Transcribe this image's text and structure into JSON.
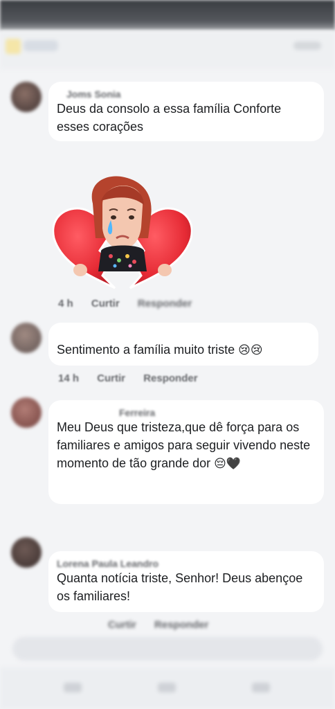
{
  "comments": [
    {
      "author": "Joms Sonia",
      "text": "Deus da consolo a essa família Conforte esses corações",
      "time": "4 h",
      "like": "Curtir",
      "reply": "Responder"
    },
    {
      "author": "",
      "text": "Sentimento a família  muito triste",
      "emoji": "😢😢",
      "time": "14 h",
      "like": "Curtir",
      "reply": "Responder"
    },
    {
      "author": "Ferreira",
      "text": "Meu Deus que tristeza,que dê força para os familiares e amigos para seguir vivendo neste momento de tão grande dor",
      "emoji": "😔🖤",
      "time": "",
      "like": "",
      "reply": ""
    },
    {
      "author": "Lorena Paula Leandro",
      "text": "Quanta notícia triste, Senhor! Deus abençoe os familiares!",
      "time": "",
      "like": "Curtir",
      "reply": "Responder"
    }
  ],
  "sticker": {
    "icon": "broken-heart-crying-girl-sticker"
  }
}
